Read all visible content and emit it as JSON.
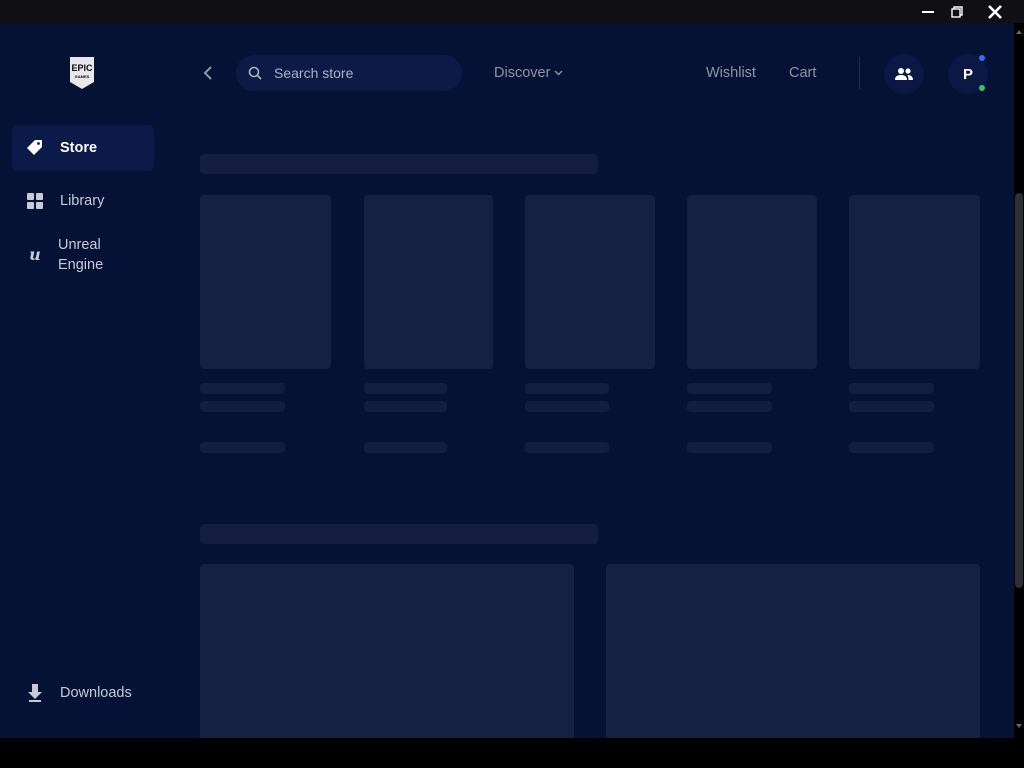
{
  "window": {
    "controls": [
      "minimize-icon",
      "restore-icon",
      "close-icon"
    ]
  },
  "sidebar": {
    "logo": {
      "text_line1": "EPIC",
      "text_line2": "GAMES"
    },
    "items": [
      {
        "label": "Store",
        "icon": "tag-icon",
        "active": true
      },
      {
        "label": "Library",
        "icon": "grid-icon",
        "active": false
      },
      {
        "label": "Unreal Engine",
        "icon": "unreal-icon",
        "active": false
      }
    ],
    "downloads": {
      "label": "Downloads",
      "icon": "download-icon"
    }
  },
  "header": {
    "search": {
      "placeholder": "Search store",
      "value": ""
    },
    "discover": {
      "label": "Discover"
    },
    "wishlist": {
      "label": "Wishlist"
    },
    "cart": {
      "label": "Cart"
    },
    "avatar": {
      "initial": "P"
    }
  },
  "colors": {
    "background": "#061235",
    "sidebar_active": "#0c1a4a",
    "skeleton": "#161f44",
    "status_online": "#3bc35a",
    "notification": "#2f6ff0"
  }
}
